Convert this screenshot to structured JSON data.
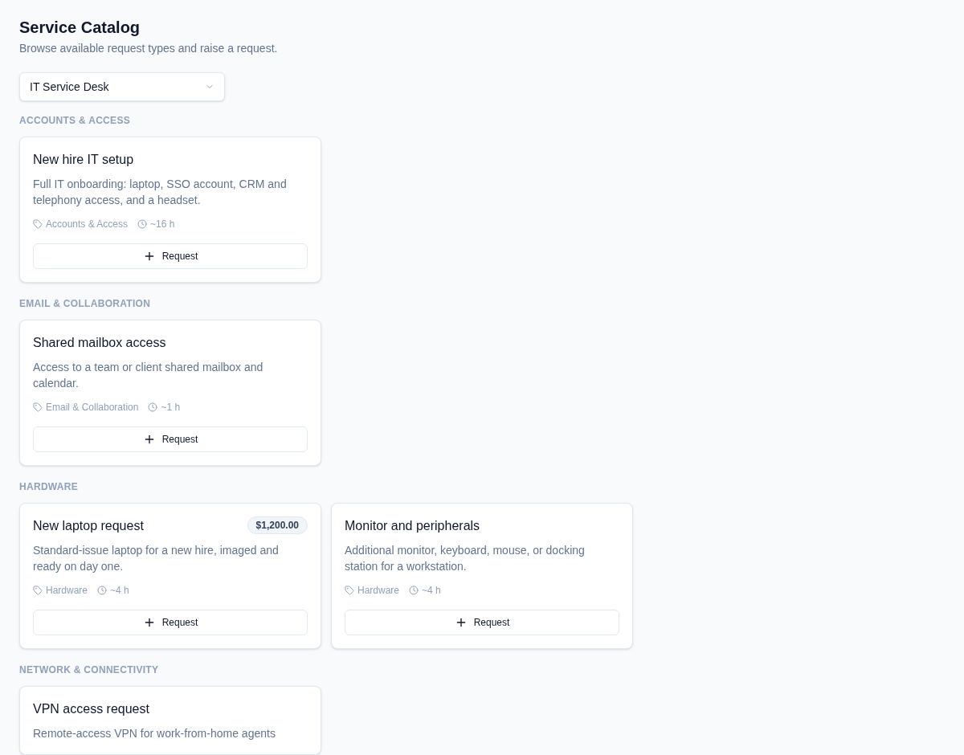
{
  "header": {
    "title": "Service Catalog",
    "subtitle": "Browse available request types and raise a request."
  },
  "catalog_select": {
    "value": "IT Service Desk"
  },
  "sections": [
    {
      "label": "ACCOUNTS & ACCESS",
      "items": [
        {
          "title": "New hire IT setup",
          "description": "Full IT onboarding: laptop, SSO account, CRM and telephony access, and a headset.",
          "category": "Accounts & Access",
          "duration": "~16 h",
          "button": "Request"
        }
      ]
    },
    {
      "label": "EMAIL & COLLABORATION",
      "items": [
        {
          "title": "Shared mailbox access",
          "description": "Access to a team or client shared mailbox and calendar.",
          "category": "Email & Collaboration",
          "duration": "~1 h",
          "button": "Request"
        }
      ]
    },
    {
      "label": "HARDWARE",
      "items": [
        {
          "title": "New laptop request",
          "price": "$1,200.00",
          "description": "Standard-issue laptop for a new hire, imaged and ready on day one.",
          "category": "Hardware",
          "duration": "~4 h",
          "button": "Request"
        },
        {
          "title": "Monitor and peripherals",
          "description": "Additional monitor, keyboard, mouse, or docking station for a workstation.",
          "category": "Hardware",
          "duration": "~4 h",
          "button": "Request"
        }
      ]
    },
    {
      "label": "NETWORK & CONNECTIVITY",
      "items": [
        {
          "title": "VPN access request",
          "description": "Remote-access VPN for work-from-home agents"
        }
      ]
    }
  ]
}
